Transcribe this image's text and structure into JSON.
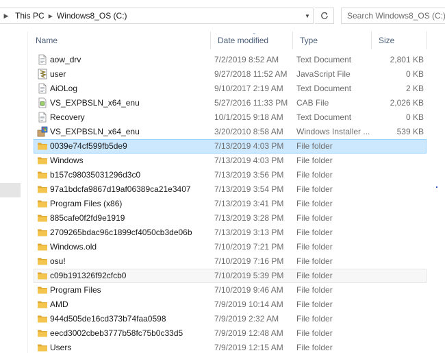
{
  "address": {
    "crumbs": [
      "This PC",
      "Windows8_OS (C:)"
    ],
    "search_placeholder": "Search Windows8_OS (C:)"
  },
  "columns": {
    "name": "Name",
    "date": "Date modified",
    "type": "Type",
    "size": "Size"
  },
  "files": [
    {
      "name": "aow_drv",
      "date": "7/2/2019 8:52 AM",
      "type": "Text Document",
      "size": "2,801 KB",
      "icon": "text-document-icon"
    },
    {
      "name": "user",
      "date": "9/27/2018 11:52 AM",
      "type": "JavaScript File",
      "size": "0 KB",
      "icon": "javascript-file-icon"
    },
    {
      "name": "AiOLog",
      "date": "9/10/2017 2:19 AM",
      "type": "Text Document",
      "size": "2 KB",
      "icon": "text-document-icon"
    },
    {
      "name": "VS_EXPBSLN_x64_enu",
      "date": "5/27/2016 11:33 PM",
      "type": "CAB File",
      "size": "2,026 KB",
      "icon": "cab-file-icon"
    },
    {
      "name": "Recovery",
      "date": "10/1/2015 9:18 AM",
      "type": "Text Document",
      "size": "0 KB",
      "icon": "text-document-icon"
    },
    {
      "name": "VS_EXPBSLN_x64_enu",
      "date": "3/20/2010 8:58 AM",
      "type": "Windows Installer ...",
      "size": "539 KB",
      "icon": "installer-package-icon"
    },
    {
      "name": "0039e74cf599fb5de9",
      "date": "7/13/2019 4:03 PM",
      "type": "File folder",
      "size": "",
      "icon": "folder-icon",
      "state": "selected"
    },
    {
      "name": "Windows",
      "date": "7/13/2019 4:03 PM",
      "type": "File folder",
      "size": "",
      "icon": "folder-icon"
    },
    {
      "name": "b157c98035031296d3c0",
      "date": "7/13/2019 3:56 PM",
      "type": "File folder",
      "size": "",
      "icon": "folder-icon"
    },
    {
      "name": "97a1bdcfa9867d19af06389ca21e3407",
      "date": "7/13/2019 3:54 PM",
      "type": "File folder",
      "size": "",
      "icon": "folder-icon"
    },
    {
      "name": "Program Files (x86)",
      "date": "7/13/2019 3:41 PM",
      "type": "File folder",
      "size": "",
      "icon": "folder-icon"
    },
    {
      "name": "885cafe0f2fd9e1919",
      "date": "7/13/2019 3:28 PM",
      "type": "File folder",
      "size": "",
      "icon": "folder-icon"
    },
    {
      "name": "2709265bdac96c1899cf4050cb3de06b",
      "date": "7/13/2019 3:13 PM",
      "type": "File folder",
      "size": "",
      "icon": "folder-icon"
    },
    {
      "name": "Windows.old",
      "date": "7/10/2019 7:21 PM",
      "type": "File folder",
      "size": "",
      "icon": "folder-icon"
    },
    {
      "name": "osu!",
      "date": "7/10/2019 7:16 PM",
      "type": "File folder",
      "size": "",
      "icon": "folder-icon"
    },
    {
      "name": "c09b191326f92cfcb0",
      "date": "7/10/2019 5:39 PM",
      "type": "File folder",
      "size": "",
      "icon": "folder-icon",
      "state": "hover"
    },
    {
      "name": "Program Files",
      "date": "7/10/2019 9:46 AM",
      "type": "File folder",
      "size": "",
      "icon": "folder-icon"
    },
    {
      "name": "AMD",
      "date": "7/9/2019 10:14 AM",
      "type": "File folder",
      "size": "",
      "icon": "folder-icon"
    },
    {
      "name": "944d505de16cd373b74faa0598",
      "date": "7/9/2019 2:32 AM",
      "type": "File folder",
      "size": "",
      "icon": "folder-icon"
    },
    {
      "name": "eecd3002cbeb3777b58fc75b0c33d5",
      "date": "7/9/2019 12:48 AM",
      "type": "File folder",
      "size": "",
      "icon": "folder-icon"
    },
    {
      "name": "Users",
      "date": "7/9/2019 12:15 AM",
      "type": "File folder",
      "size": "",
      "icon": "folder-icon"
    }
  ],
  "colors": {
    "selected_bg": "#cce8ff",
    "selected_border": "#99d1ff",
    "header_text": "#4c607a",
    "folder_yellow": "#e8b83a"
  }
}
